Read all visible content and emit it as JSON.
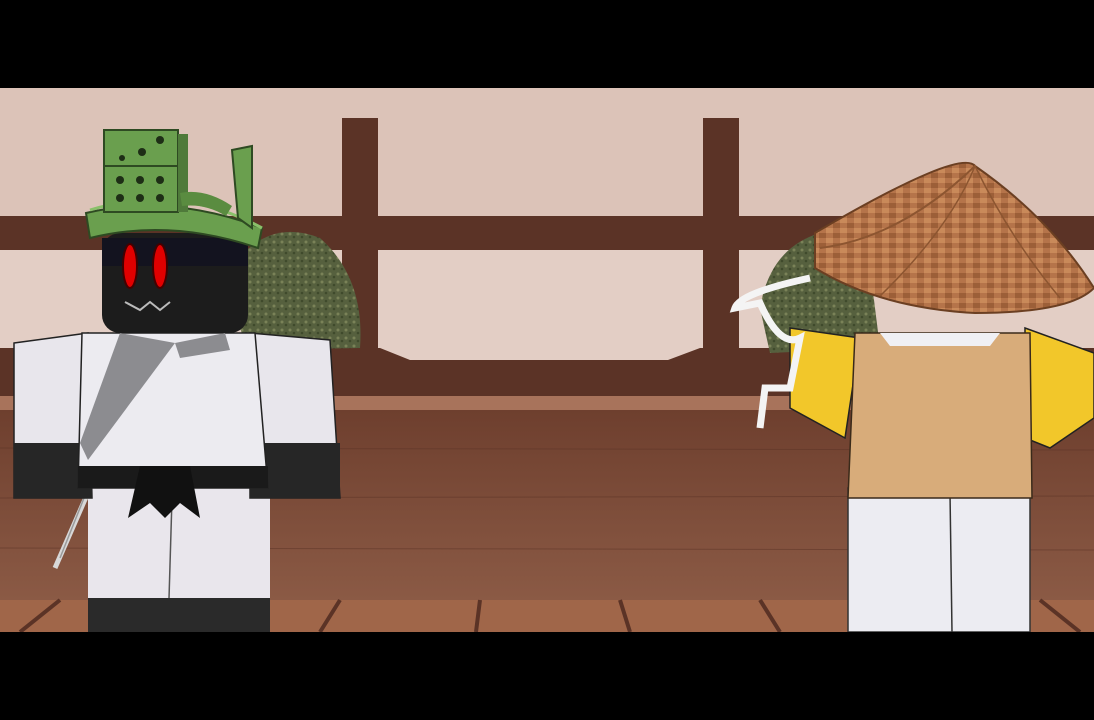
{
  "scene": {
    "description_free": true,
    "colors": {
      "wall": "#e4cfc6",
      "wood_dark": "#5b3326",
      "wood_mid": "#7a4a37",
      "floor": "#8b5a45",
      "ledge": "#a8735b",
      "bush": "#55613c",
      "gi": "#e9e6ec",
      "belt": "#1a1a1a",
      "head": "#1c1c1c",
      "eyes": "#e00000",
      "helmet": "#6a9f4e",
      "straw_hat": "#b8784a",
      "shirt": "#d8ac7a",
      "arms_yellow": "#f2c72a",
      "pants": "#ececf2"
    },
    "icons": [
      "domino-hat-icon",
      "straw-hat-icon",
      "katana-icon"
    ]
  }
}
